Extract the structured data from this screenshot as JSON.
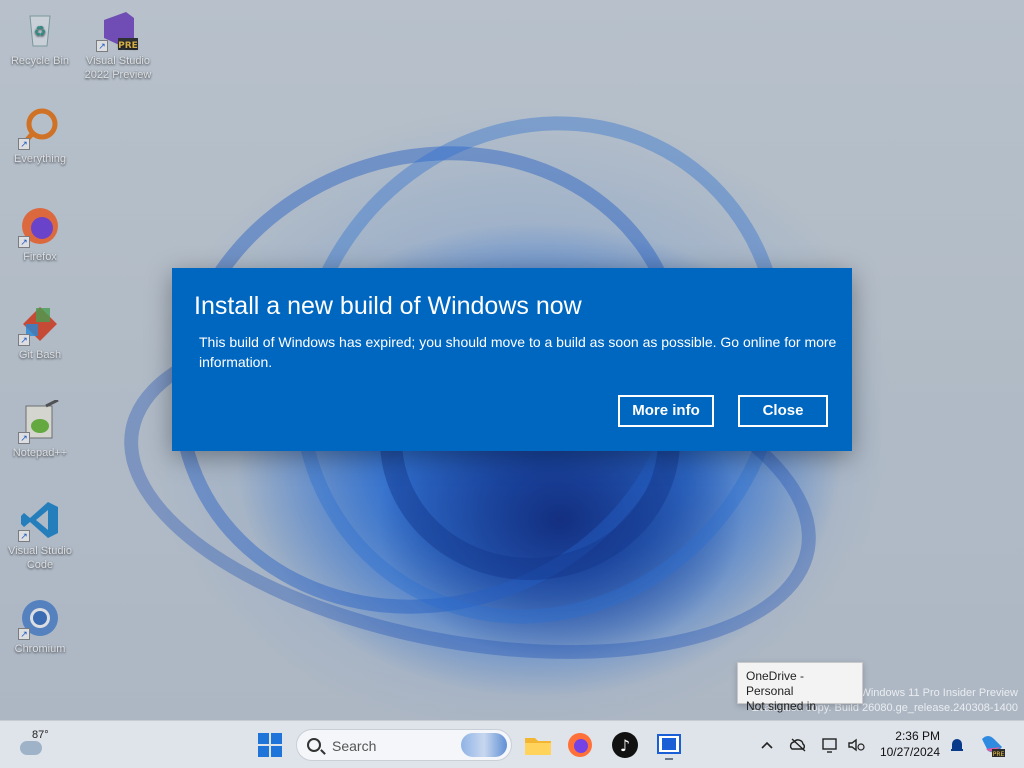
{
  "desktop": {
    "icons": [
      {
        "label": "Recycle Bin",
        "icon": "recycle-bin-icon"
      },
      {
        "label": "Visual Studio 2022 Preview",
        "icon": "visual-studio-icon",
        "badge": "PRE"
      },
      {
        "label": "Everything",
        "icon": "everything-search-icon"
      },
      {
        "label": "Firefox",
        "icon": "firefox-icon"
      },
      {
        "label": "Git Bash",
        "icon": "git-bash-icon"
      },
      {
        "label": "Notepad++",
        "icon": "notepad-plus-plus-icon"
      },
      {
        "label": "Visual Studio Code",
        "icon": "vscode-icon"
      },
      {
        "label": "Chromium",
        "icon": "chromium-icon"
      }
    ]
  },
  "dialog": {
    "title": "Install a new build of Windows now",
    "message": "This build of Windows has expired; you should move to a build as soon as possible. Go online for more information.",
    "more_info_label": "More info",
    "close_label": "Close",
    "background_color": "#0067c0"
  },
  "tooltip": {
    "line1": "OneDrive - Personal",
    "line2": "Not signed in"
  },
  "watermark": {
    "line1": "Windows 11 Pro Insider Preview",
    "line2": "Evaluation copy. Build 26080.ge_release.240308-1400"
  },
  "taskbar": {
    "weather_temp": "87°",
    "search_placeholder": "Search",
    "apps": [
      "file-explorer-icon",
      "firefox-icon",
      "tiktok-icon",
      "window-app-icon"
    ],
    "time": "2:36 PM",
    "date": "10/27/2024"
  }
}
